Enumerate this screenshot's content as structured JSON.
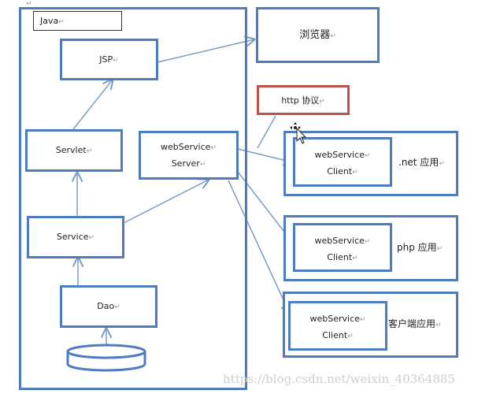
{
  "diagram": {
    "outer_container": {
      "label": "Java"
    },
    "nodes": {
      "jsp": {
        "label": "JSP"
      },
      "servlet": {
        "label": "Servlet"
      },
      "service": {
        "label": "Service"
      },
      "dao": {
        "label": "Dao"
      },
      "ws_server": {
        "line1": "webService",
        "line2": "Server"
      },
      "browser": {
        "label": "浏览器"
      },
      "http": {
        "label": "http 协议"
      },
      "net_app": {
        "label": ".net 应用",
        "client_line1": "webService",
        "client_line2": "Client"
      },
      "php_app": {
        "label": "php 应用",
        "client_line1": "webService",
        "client_line2": "Client"
      },
      "client_app": {
        "label": "客户端应用",
        "client_line1": "webService",
        "client_line2": "Client"
      },
      "database": {
        "label": ""
      }
    },
    "edges": [
      {
        "from": "database",
        "to": "dao"
      },
      {
        "from": "dao",
        "to": "service"
      },
      {
        "from": "service",
        "to": "servlet"
      },
      {
        "from": "servlet",
        "to": "jsp"
      },
      {
        "from": "jsp",
        "to": "browser"
      },
      {
        "from": "service",
        "to": "ws_server"
      },
      {
        "from": "ws_server",
        "to": "net_app"
      },
      {
        "from": "ws_server",
        "to": "php_app"
      },
      {
        "from": "ws_server",
        "to": "client_app"
      },
      {
        "from": "http",
        "to": "ws_server-to-net_app edge",
        "style": "annotation"
      }
    ],
    "return_mark": "↵",
    "colors": {
      "box_border": "#4f7bbf",
      "http_border": "#c0504d",
      "edge": "#7a9cc9"
    }
  },
  "watermark": {
    "url": "https://blog.csdn.net/weixin_40364885"
  }
}
